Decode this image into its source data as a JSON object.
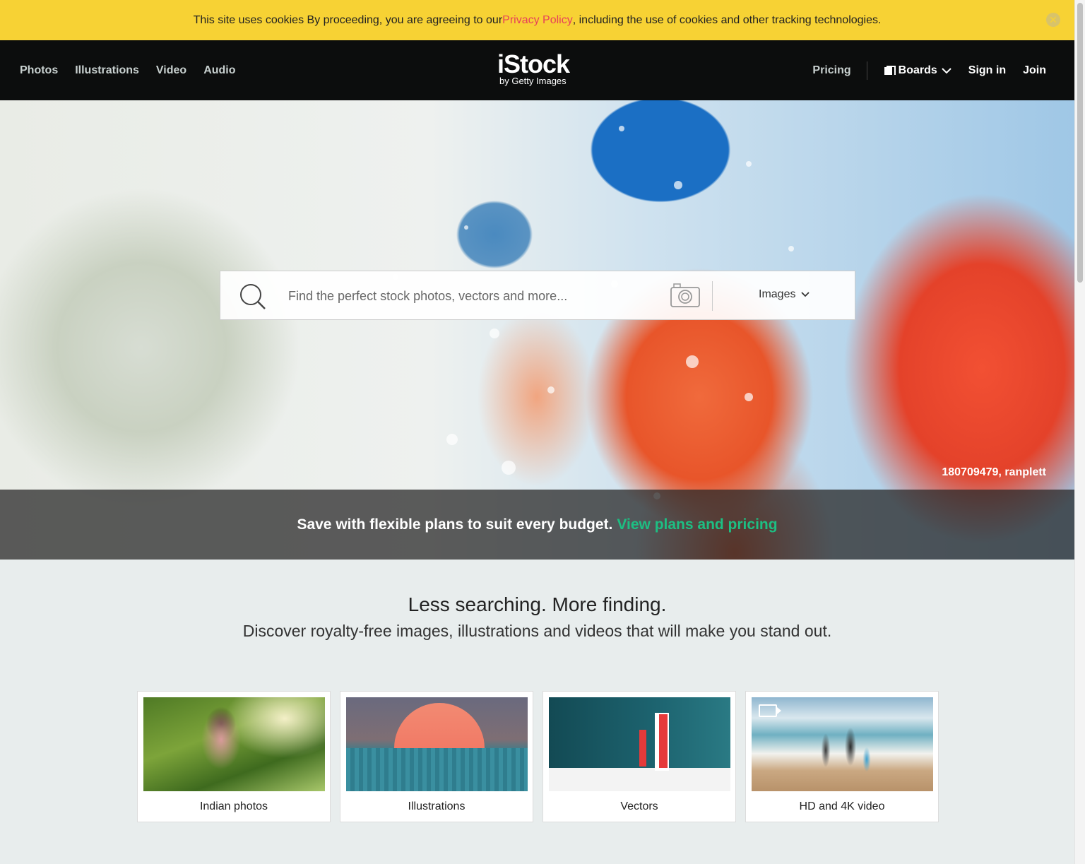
{
  "cookie_bar": {
    "text_before": "This site uses cookies By proceeding, you are agreeing to our ",
    "link": "Privacy Policy",
    "text_after": ", including the use of cookies and other tracking technologies.",
    "close_icon": "close-icon"
  },
  "header": {
    "nav_left": [
      "Photos",
      "Illustrations",
      "Video",
      "Audio"
    ],
    "logo": {
      "main": "iStock",
      "sub": "by Getty Images"
    },
    "pricing": "Pricing",
    "boards": "Boards",
    "sign_in": "Sign in",
    "join": "Join"
  },
  "search": {
    "placeholder": "Find the perfect stock photos, vectors and more...",
    "type_selected": "Images"
  },
  "hero": {
    "credit": "180709479, ranplett",
    "promo_text": "Save with flexible plans to suit every budget.",
    "promo_link": "View plans and pricing"
  },
  "intro": {
    "title": "Less searching. More finding.",
    "subtitle": "Discover royalty-free images, illustrations and videos that will make you stand out."
  },
  "cards": [
    {
      "label": "Indian photos"
    },
    {
      "label": "Illustrations"
    },
    {
      "label": "Vectors"
    },
    {
      "label": "HD and 4K video"
    }
  ],
  "colors": {
    "cookie_bg": "#f7d234",
    "privacy_link": "#e8405a",
    "header_bg": "#0c0d0d",
    "promo_link": "#1dbf83",
    "page_bg": "#e8eded"
  }
}
